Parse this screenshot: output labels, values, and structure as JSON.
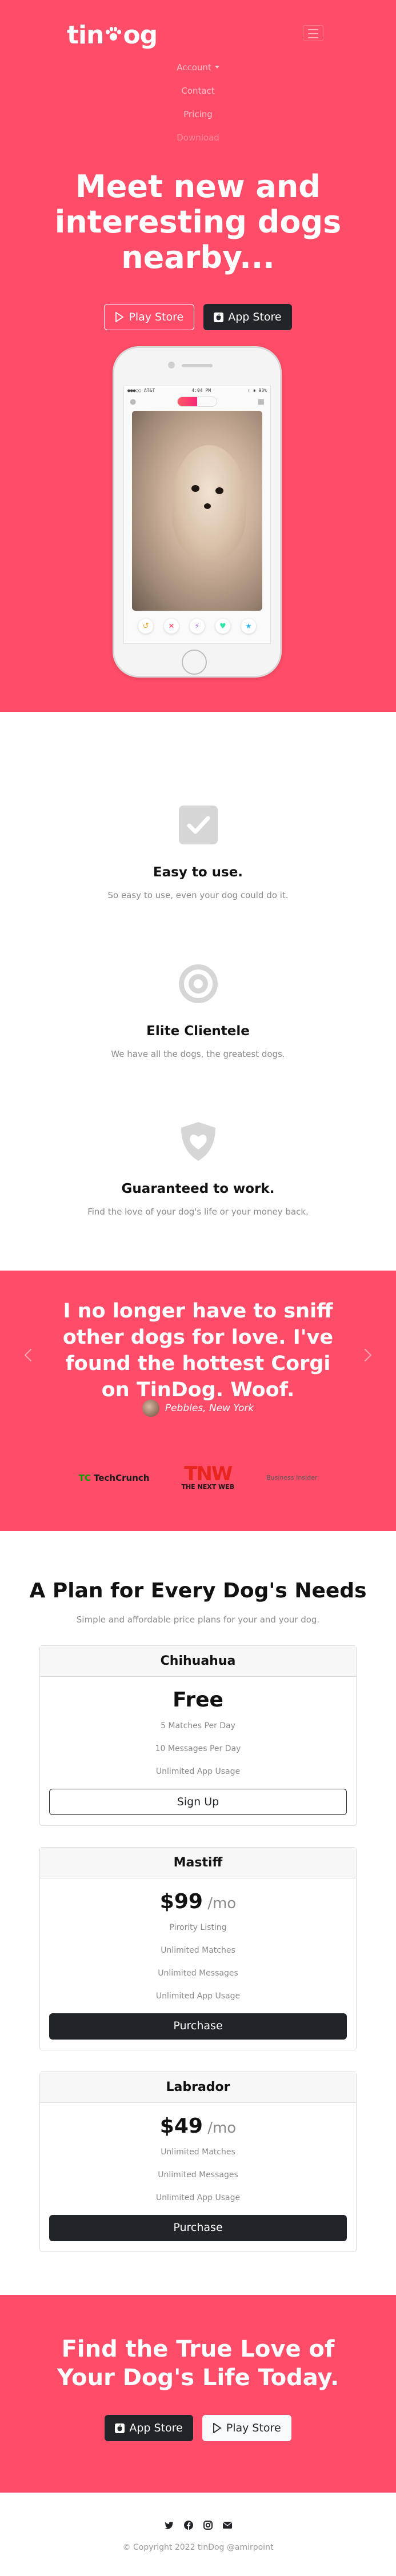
{
  "nav": {
    "brand_prefix": "tin",
    "brand_suffix": "og",
    "links": [
      "Account",
      "Contact",
      "Pricing",
      "Download"
    ]
  },
  "hero": {
    "title": "Meet new and interesting dogs nearby...",
    "play_store": "Play Store",
    "app_store": "App Store"
  },
  "phone": {
    "status_carrier": "●●●○○ AT&T",
    "status_time": "4:04 PM",
    "status_battery": "↑ ✱ 93%"
  },
  "features": [
    {
      "title": "Easy to use.",
      "text": "So easy to use, even your dog could do it.",
      "icon": "check-icon"
    },
    {
      "title": "Elite Clientele",
      "text": "We have all the dogs, the greatest dogs.",
      "icon": "bullseye-icon"
    },
    {
      "title": "Guaranteed to work.",
      "text": "Find the love of your dog's life or your money back.",
      "icon": "heart-shield-icon"
    }
  ],
  "testimonial": {
    "quote": "I no longer have to sniff other dogs for love. I've found the hottest Corgi on TinDog. Woof.",
    "author": "Pebbles, New York"
  },
  "press": {
    "techcrunch_tc": "TC",
    "techcrunch_name": "TechCrunch",
    "tnw_big": "TNW",
    "tnw_small": "THE NEXT WEB",
    "bizinsider": "Business Insider"
  },
  "pricing": {
    "title": "A Plan for Every Dog's Needs",
    "subtitle": "Simple and affordable price plans for your and your dog.",
    "plans": [
      {
        "name": "Chihuahua",
        "price": "Free",
        "unit": "",
        "features": [
          "5 Matches Per Day",
          "10 Messages Per Day",
          "Unlimited App Usage"
        ],
        "button": "Sign Up"
      },
      {
        "name": "Mastiff",
        "price": "$99",
        "unit": " /mo",
        "features": [
          "Pirority Listing",
          "Unlimited Matches",
          "Unlimited Messages",
          "Unlimited App Usage"
        ],
        "button": "Purchase"
      },
      {
        "name": "Labrador",
        "price": "$49",
        "unit": " /mo",
        "features": [
          "Unlimited Matches",
          "Unlimited Messages",
          "Unlimited App Usage"
        ],
        "button": "Purchase"
      }
    ]
  },
  "cta": {
    "title": "Find the True Love of Your Dog's Life Today.",
    "app_store": "App Store",
    "play_store": "Play Store"
  },
  "footer": {
    "socials": [
      "twitter-icon",
      "facebook-icon",
      "instagram-icon",
      "envelope-icon"
    ],
    "copyright": "© Copyright 2022 tinDog @amirpoint"
  },
  "colors": {
    "brand": "#ff4c68",
    "dark": "#212529"
  }
}
